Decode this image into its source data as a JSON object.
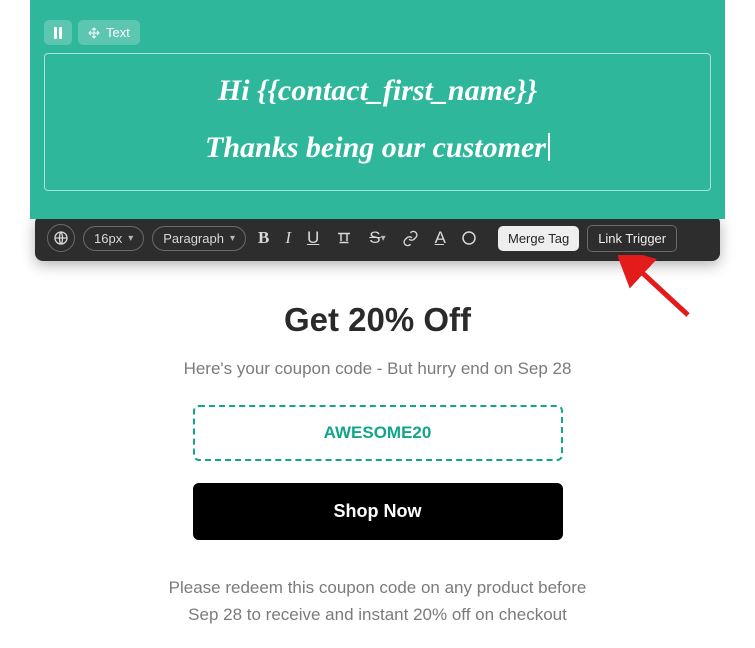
{
  "header": {
    "pill_text": "Text",
    "heading_line1": "Hi {{contact_first_name}}",
    "heading_line2": "Thanks being our customer"
  },
  "toolbar": {
    "font_size": "16px",
    "format": "Paragraph",
    "merge_tag": "Merge Tag",
    "link_trigger": "Link Trigger"
  },
  "body": {
    "title": "Get 20% Off",
    "subtitle": "Here's your coupon code - But hurry end on Sep 28",
    "coupon_code": "AWESOME20",
    "cta": "Shop Now",
    "note_line1": "Please redeem this coupon code on any product before",
    "note_line2": "Sep 28 to receive and instant 20% off on checkout"
  },
  "colors": {
    "accent": "#2fb79b",
    "coupon": "#11a58a"
  }
}
